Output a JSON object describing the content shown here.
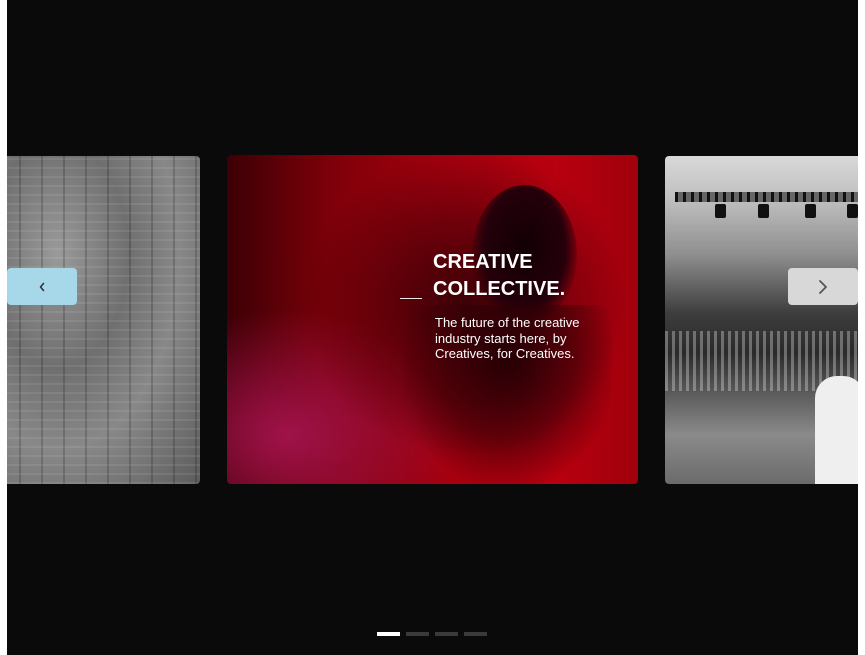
{
  "carousel": {
    "active_slide": {
      "headline_line1": "CREATIVE",
      "headline_line2": "COLLECTIVE.",
      "tagline_line1": "The future of the creative",
      "tagline_line2": "industry starts here, by",
      "tagline_line3": "Creatives, for Creatives."
    },
    "prev_button": {
      "icon": "chevron-left-icon"
    },
    "next_button": {
      "icon": "chevron-right-icon"
    },
    "pagination": {
      "total": 4,
      "active_index": 0
    },
    "colors": {
      "background": "#0a0a0b",
      "accent_red": "#a7000e",
      "prev_button_bg": "#a6d8ea",
      "next_button_bg": "#d8d8d8"
    }
  }
}
